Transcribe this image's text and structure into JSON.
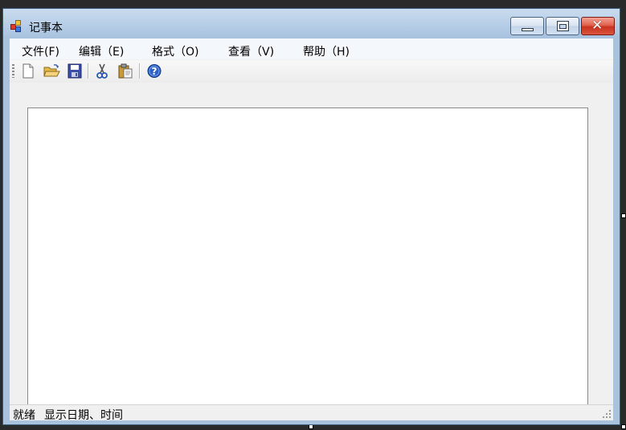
{
  "window": {
    "title": "记事本"
  },
  "menu": [
    {
      "label": "文件(F)"
    },
    {
      "label": "编辑（E)"
    },
    {
      "label": "格式（O)"
    },
    {
      "label": "查看（V)"
    },
    {
      "label": "帮助（H)"
    }
  ],
  "toolbar": {
    "icons": [
      "new-file-icon",
      "open-folder-icon",
      "save-icon",
      "cut-icon",
      "paste-icon",
      "help-icon"
    ]
  },
  "editor": {
    "value": ""
  },
  "status": {
    "state": "就绪",
    "datetime": "显示日期、时间"
  },
  "colors": {
    "title_bar": "#b8cfe8",
    "close_button": "#d8553f",
    "client_bg": "#f0f0f0",
    "menubar_bg": "#f4f7fb"
  }
}
